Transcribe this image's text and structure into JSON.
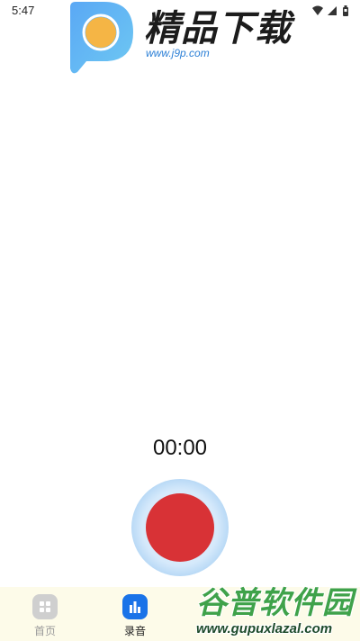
{
  "status_bar": {
    "time": "5:47",
    "icons": [
      "wifi-icon",
      "signal-icon",
      "battery-icon"
    ]
  },
  "watermark_top": {
    "title": "精品下载",
    "url": "www.j9p.com"
  },
  "recorder": {
    "timer": "00:00",
    "record_color": "#d83236",
    "ring_color": "#a8d0f3"
  },
  "bottom_nav": {
    "items": [
      {
        "label": "首页",
        "icon": "grid-icon",
        "active": false
      },
      {
        "label": "录音",
        "icon": "bar-chart-icon",
        "active": true
      }
    ],
    "active_color": "#1a73e8",
    "background": "#fdfbe9"
  },
  "watermark_bottom": {
    "title": "谷普软件园",
    "url": "www.gupuxlazal.com"
  }
}
